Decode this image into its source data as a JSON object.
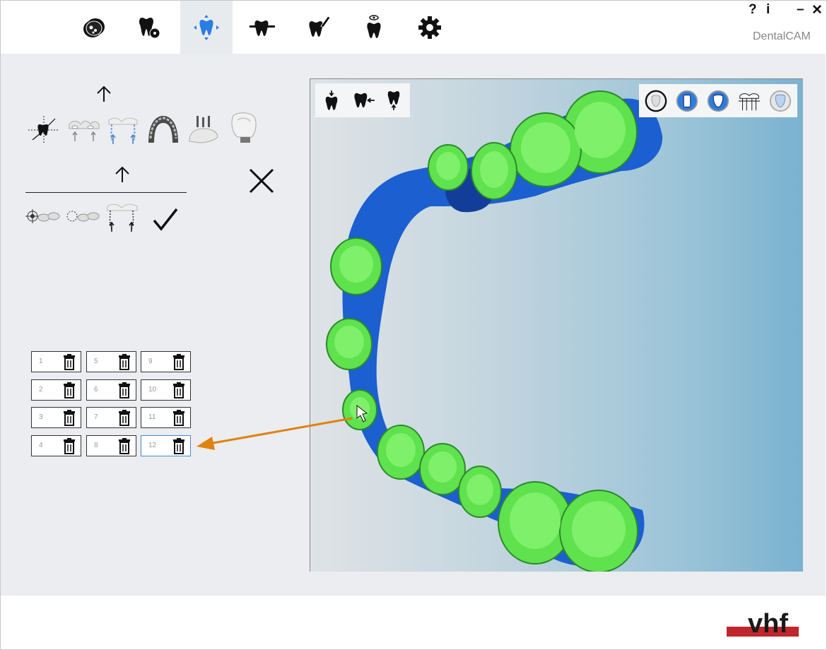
{
  "app": {
    "title": "DentalCAM"
  },
  "window_controls": {
    "help": "?",
    "info": "i",
    "minimize": "–",
    "close": "✕"
  },
  "tabs": [
    {
      "id": "job",
      "icon": "blank-disc-icon"
    },
    {
      "id": "add-object",
      "icon": "tooth-add-icon"
    },
    {
      "id": "nesting",
      "icon": "tooth-move-icon",
      "active": true
    },
    {
      "id": "prep",
      "icon": "tooth-tool-icon"
    },
    {
      "id": "calc",
      "icon": "tooth-mill-icon"
    },
    {
      "id": "view",
      "icon": "tooth-eye-icon"
    },
    {
      "id": "settings",
      "icon": "gear-icon"
    }
  ],
  "left_panel": {
    "tools_row1": [
      "position-icon",
      "support-pins-icon",
      "connectors-icon",
      "jaw-icon",
      "pins-tooth-icon",
      "abutment-icon"
    ],
    "tools_row2": [
      "target-objects-icon",
      "rotate-objects-icon",
      "sinter-pins-icon"
    ],
    "cancel": "close-icon",
    "confirm": "check-icon",
    "slots": [
      {
        "number": "1"
      },
      {
        "number": "2"
      },
      {
        "number": "3"
      },
      {
        "number": "4"
      },
      {
        "number": "5"
      },
      {
        "number": "6"
      },
      {
        "number": "7"
      },
      {
        "number": "8"
      },
      {
        "number": "9"
      },
      {
        "number": "10"
      },
      {
        "number": "11"
      },
      {
        "number": "12",
        "selected": true
      }
    ]
  },
  "viewport": {
    "left_tools": [
      "tooth-top-view-icon",
      "tooth-side-view-icon",
      "tooth-bottom-view-icon"
    ],
    "right_tools": [
      "outline-view-icon",
      "solid-view-icon",
      "crown-view-icon",
      "bridge-view-icon",
      "transparent-view-icon"
    ],
    "colors": {
      "model": "#1b5fd0",
      "prep": "#5fe24d",
      "prep_outline": "#2b8a2a"
    }
  },
  "annotation": {
    "color": "#e0820e"
  },
  "brand": {
    "logo": "vhf",
    "accent": "#c0272d"
  }
}
